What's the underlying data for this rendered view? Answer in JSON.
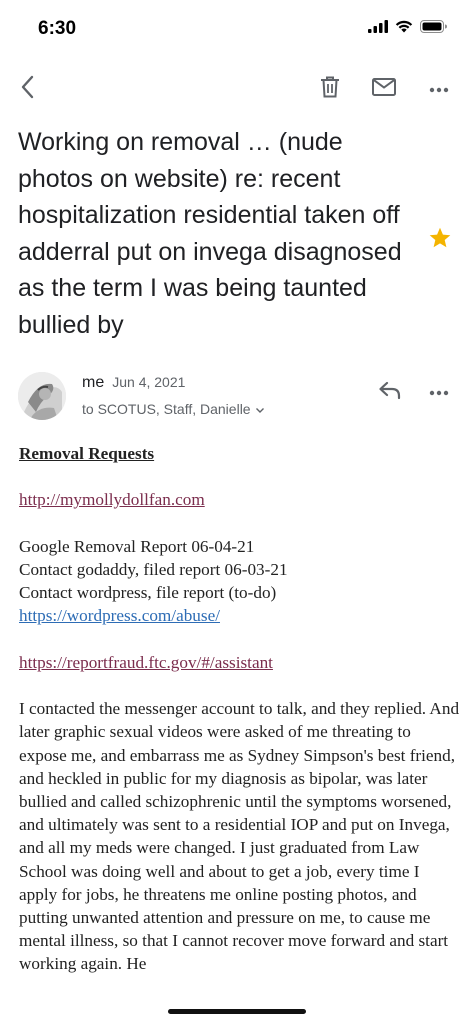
{
  "status_bar": {
    "time": "6:30",
    "icons": [
      "cellular-signal-icon",
      "wifi-icon",
      "battery-icon"
    ]
  },
  "toolbar": {
    "back_icon": "chevron-left-icon",
    "actions": [
      "trash-icon",
      "mail-icon",
      "more-horizontal-icon"
    ]
  },
  "email": {
    "subject": "Working on removal … (nude photos on website) re: recent hospitalization residential taken off adderral put on invega disagnosed as the term I was being taunted bullied by",
    "starred": true,
    "sender": "me",
    "date": "Jun 4, 2021",
    "recipients": "to SCOTUS, Staff, Danielle",
    "body": {
      "heading": "Removal Requests",
      "link1": "http://mymollydollfan.com",
      "lines": [
        "Google Removal Report 06-04-21",
        "Contact godaddy, filed report 06-03-21",
        "Contact wordpress, file report (to-do)"
      ],
      "link2": "https://wordpress.com/abuse/",
      "link3": "https://reportfraud.ftc.gov/#/assistant",
      "paragraph": "I contacted the messenger account to talk, and they replied. And later graphic sexual videos were asked of me threating to expose me, and embarrass me as Sydney Simpson's best friend, and heckled in public for my diagnosis as bipolar, was later bullied and called schizophrenic until the symptoms worsened, and ultimately was sent to a residential IOP and put on Invega, and all my meds were changed. I just graduated from Law School was doing well and about to get a job, every time I apply for jobs, he threatens me online posting photos, and putting unwanted attention and pressure on me, to cause me mental illness, so that I cannot recover move forward and start working again. He"
    }
  },
  "colors": {
    "star": "#f4b400",
    "visited_link": "#7b2d4d",
    "link": "#2d6cb5",
    "secondary_text": "#5f6368"
  }
}
